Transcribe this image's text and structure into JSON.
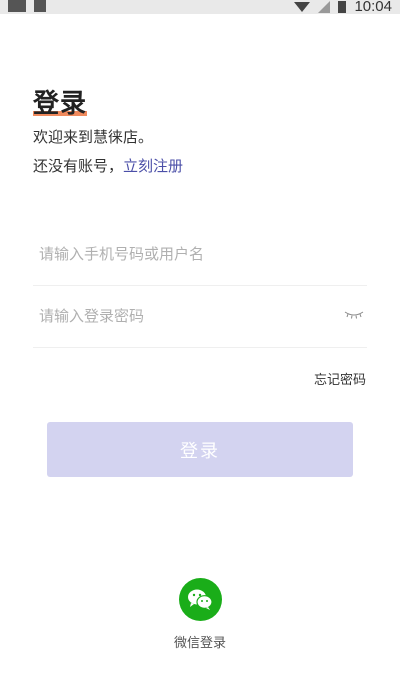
{
  "status_bar": {
    "time": "10:04"
  },
  "header": {
    "title": "登录",
    "welcome": "欢迎来到慧徕店。",
    "no_account": "还没有账号，",
    "register_link": "立刻注册"
  },
  "form": {
    "phone_placeholder": "请输入手机号码或用户名",
    "password_placeholder": "请输入登录密码",
    "forgot_password": "忘记密码",
    "login_button": "登录"
  },
  "social": {
    "wechat_label": "微信登录"
  },
  "colors": {
    "accent": "#4b4fa8",
    "title_underline": "#f08a5d",
    "button_disabled": "#d3d3f0",
    "wechat_green": "#1aad19"
  },
  "icons": [
    "eye-closed-icon",
    "wechat-icon",
    "wifi-icon",
    "signal-icon",
    "battery-icon"
  ]
}
